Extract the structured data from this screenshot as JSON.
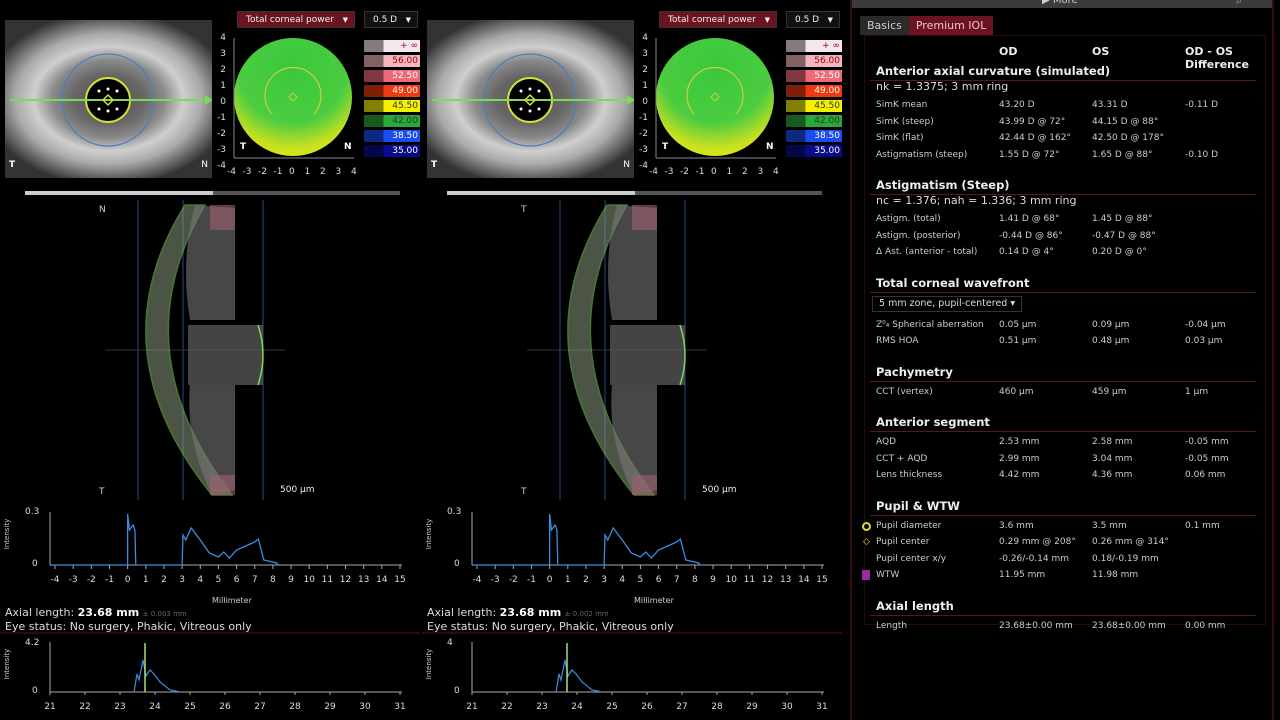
{
  "eyes": [
    {
      "id": "od",
      "map_dropdown": "Total corneal power",
      "step_dropdown": "0.5 D",
      "map_label_t": "T",
      "map_label_n": "N",
      "img_label_t": "T",
      "img_label_n": "N",
      "oct_label_n": "N",
      "oct_label_t": "T",
      "scale_bar": "500 µm",
      "axial_length_label": "Axial length:",
      "axial_length_value": "23.68 mm",
      "axial_length_sd": "± 0.003 mm",
      "eye_status": "Eye status: No surgery, Phakic, Vitreous only",
      "ascan_ymax": "0.3",
      "ascan_ymin": "0",
      "ascan_ylabel": "Intensity",
      "ascan_xlabel": "Millimeter",
      "peak_ymax": "4.2",
      "peak_ymin": "0",
      "peak_ylabel": "Intensity"
    },
    {
      "id": "os",
      "map_dropdown": "Total corneal power",
      "step_dropdown": "0.5 D",
      "map_label_t": "T",
      "map_label_n": "N",
      "img_label_t": "T",
      "img_label_n": "N",
      "oct_label_n": "T",
      "oct_label_t": "T",
      "scale_bar": "500 µm",
      "axial_length_label": "Axial length:",
      "axial_length_value": "23.68 mm",
      "axial_length_sd": "± 0.002 mm",
      "eye_status": "Eye status: No surgery, Phakic, Vitreous only",
      "ascan_ymax": "0.3",
      "ascan_ymin": "0",
      "ascan_ylabel": "Intensity",
      "ascan_xlabel": "Millimeter",
      "peak_ymax": "4",
      "peak_ymin": "0",
      "peak_ylabel": "Intensity"
    }
  ],
  "map_axis_ticks": [
    "4",
    "3",
    "2",
    "1",
    "0",
    "-1",
    "-2",
    "-3",
    "-4"
  ],
  "map_x_ticks": [
    "-4",
    "-3",
    "-2",
    "-1",
    "0",
    "1",
    "2",
    "3",
    "4"
  ],
  "color_scale": [
    {
      "label": "+ ∞",
      "color": "#f4e6ee"
    },
    {
      "label": "56.00",
      "color": "#f2b6c0"
    },
    {
      "label": "52.50",
      "color": "#ee6a78"
    },
    {
      "label": "49.00",
      "color": "#ee3a10"
    },
    {
      "label": "45.50",
      "color": "#f4f000"
    },
    {
      "label": "42.00",
      "color": "#2aa838"
    },
    {
      "label": "38.50",
      "color": "#1a4cf0"
    },
    {
      "label": "35.00",
      "color": "#0a0a8a"
    }
  ],
  "ascan_x_ticks": [
    "-4",
    "-3",
    "-2",
    "-1",
    "0",
    "1",
    "2",
    "3",
    "4",
    "5",
    "6",
    "7",
    "8",
    "9",
    "10",
    "11",
    "12",
    "13",
    "14",
    "15"
  ],
  "peak_x_ticks": [
    "21",
    "22",
    "23",
    "24",
    "25",
    "26",
    "27",
    "28",
    "29",
    "30",
    "31"
  ],
  "right_panel": {
    "top_label": "More",
    "tabs": [
      {
        "label": "Basics",
        "active": false
      },
      {
        "label": "Premium IOL",
        "active": true
      }
    ],
    "col_od": "OD",
    "col_os": "OS",
    "col_diff_1": "OD - OS",
    "col_diff_2": "Difference",
    "sections": [
      {
        "title": "Anterior axial curvature (simulated)",
        "subtitle": "nk = 1.3375; 3 mm ring",
        "rows": [
          [
            "SimK mean",
            "43.20 D",
            "43.31 D",
            "-0.11 D"
          ],
          [
            "SimK (steep)",
            "43.99 D @ 72°",
            "44.15 D @ 88°",
            ""
          ],
          [
            "SimK (flat)",
            "42.44 D @ 162°",
            "42.50 D @ 178°",
            ""
          ],
          [
            "Astigmatism (steep)",
            "1.55 D @ 72°",
            "1.65 D @ 88°",
            "-0.10 D"
          ]
        ]
      },
      {
        "title": "Astigmatism (Steep)",
        "subtitle": "nc = 1.376; nah = 1.336; 3 mm ring",
        "rows": [
          [
            "Astigm. (total)",
            "1.41 D @ 68°",
            "1.45 D @ 88°",
            ""
          ],
          [
            "Astigm. (posterior)",
            "-0.44 D @ 86°",
            "-0.47 D @ 88°",
            ""
          ],
          [
            "Δ Ast. (anterior - total)",
            "0.14 D @ 4°",
            "0.20 D @ 0°",
            ""
          ]
        ]
      },
      {
        "title": "Total corneal wavefront",
        "dropdown": "5 mm zone, pupil-centered",
        "rows": [
          [
            "Z⁰₄ Spherical aberration",
            "0.05 µm",
            "0.09 µm",
            "-0.04 µm"
          ],
          [
            "RMS HOA",
            "0.51 µm",
            "0.48 µm",
            "0.03 µm"
          ]
        ]
      },
      {
        "title": "Pachymetry",
        "rows": [
          [
            "CCT (vertex)",
            "460 µm",
            "459 µm",
            "1 µm"
          ]
        ]
      },
      {
        "title": "Anterior segment",
        "rows": [
          [
            "AQD",
            "2.53 mm",
            "2.58 mm",
            "-0.05 mm"
          ],
          [
            "CCT + AQD",
            "2.99 mm",
            "3.04 mm",
            "-0.05 mm"
          ],
          [
            "Lens thickness",
            "4.42 mm",
            "4.36 mm",
            "0.06 mm"
          ]
        ]
      },
      {
        "title": "Pupil & WTW",
        "rows": [
          [
            "Pupil diameter",
            "3.6 mm",
            "3.5 mm",
            "0.1 mm",
            "ring-icon"
          ],
          [
            "Pupil center",
            "0.29 mm @ 208°",
            "0.26 mm @ 314°",
            "",
            "diamond-icon"
          ],
          [
            "Pupil center x/y",
            "-0.26/-0.14 mm",
            "0.18/-0.19 mm",
            ""
          ],
          [
            "WTW",
            "11.95 mm",
            "11.98 mm",
            "",
            "wtw-icon"
          ]
        ]
      },
      {
        "title": "Axial length",
        "rows": [
          [
            "Length",
            "23.68±0.00 mm",
            "23.68±0.00 mm",
            "0.00 mm"
          ]
        ]
      }
    ]
  },
  "colors": {
    "accent": "#7a1226",
    "panel_border": "#3a0a14",
    "green": "#7ed957",
    "scan_blue": "#3b8ee0"
  }
}
